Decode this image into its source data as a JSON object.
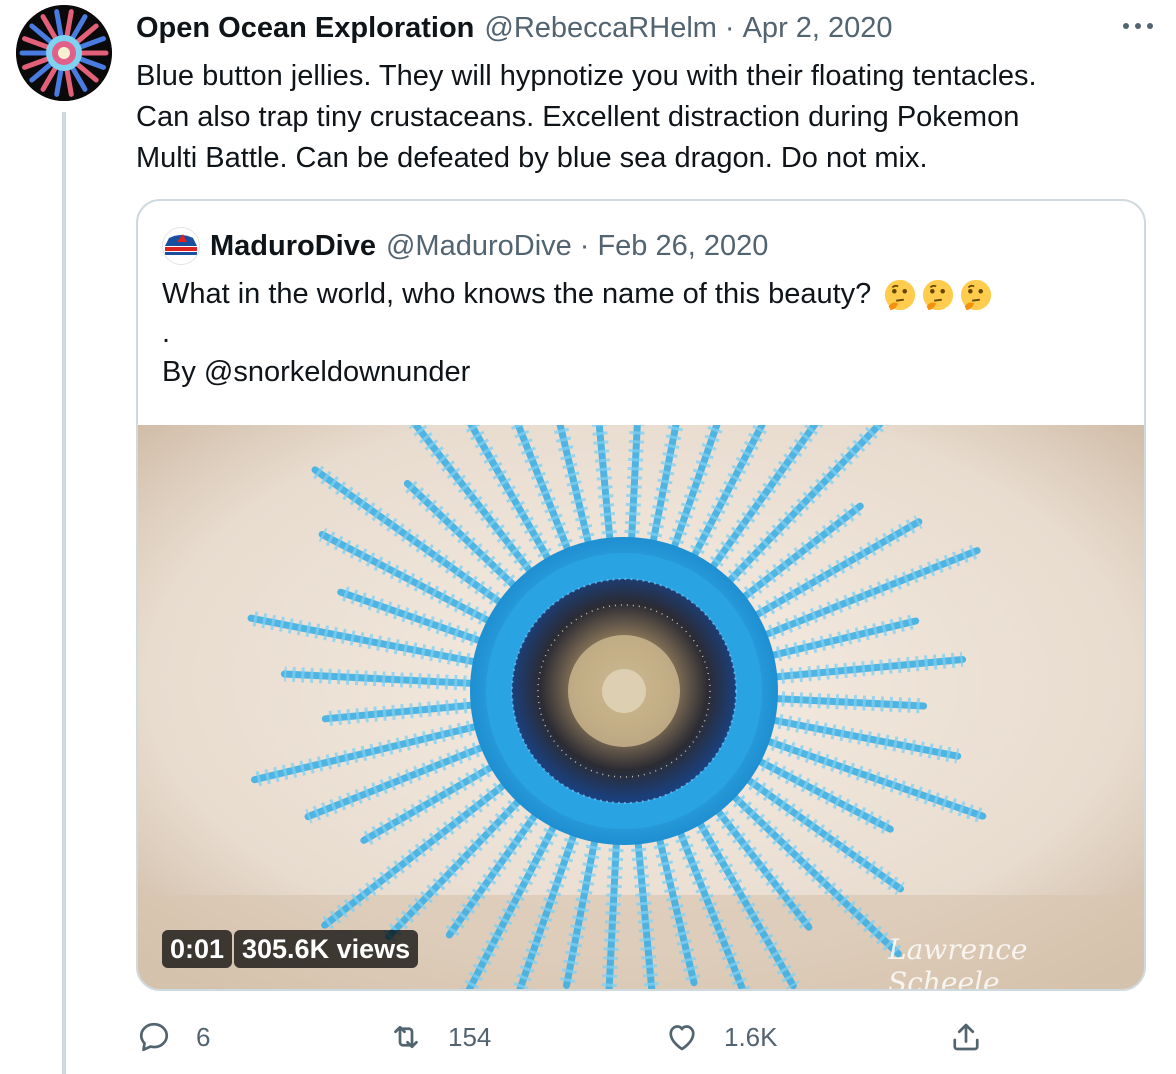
{
  "tweet": {
    "author_name": "Open Ocean Exploration",
    "handle": "@RebeccaRHelm",
    "separator": "·",
    "date": "Apr 2, 2020",
    "more_icon": "more-horizontal-icon",
    "text_lines": [
      "Blue button jellies. They will hypnotize you with their floating tentacles.",
      "Can also trap tiny crustaceans. Excellent distraction during Pokemon",
      "Multi Battle. Can be defeated by blue sea dragon. Do not mix."
    ]
  },
  "quoted": {
    "author_name": "MaduroDive",
    "handle": "@MaduroDive",
    "separator": "·",
    "date": "Feb 26, 2020",
    "text_lines": [
      "What in the world, who knows the name of this beauty?",
      ".",
      "By @snorkeldownunder"
    ],
    "emoji": [
      "thinking-face-icon",
      "thinking-face-icon",
      "thinking-face-icon"
    ],
    "video": {
      "timestamp": "0:01",
      "views": "305.6K views",
      "watermark": "Lawrence Scheele"
    }
  },
  "actions": {
    "reply": {
      "icon": "reply-icon",
      "count": "6"
    },
    "retweet": {
      "icon": "retweet-icon",
      "count": "154"
    },
    "like": {
      "icon": "heart-icon",
      "count": "1.6K"
    },
    "share": {
      "icon": "share-icon"
    }
  },
  "colors": {
    "text": "#0f1419",
    "muted": "#536471",
    "border": "#cfd9de",
    "jelly_blue": "#2fa7e0"
  }
}
